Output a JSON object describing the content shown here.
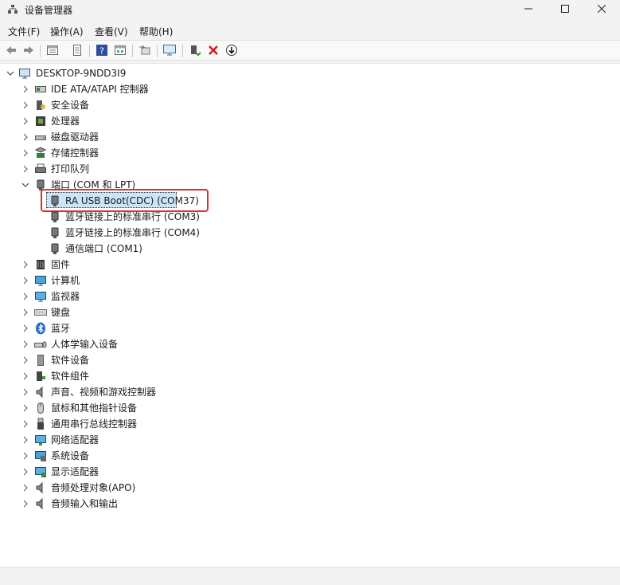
{
  "window": {
    "title": "设备管理器",
    "controls": {
      "minimize": "—",
      "maximize": "☐",
      "close": "✕"
    }
  },
  "menu": [
    "文件(F)",
    "操作(A)",
    "查看(V)",
    "帮助(H)"
  ],
  "toolbar": {
    "icons": [
      "back-arrow-icon",
      "forward-arrow-icon",
      "properties-icon",
      "show-hide-icon",
      "help-icon",
      "device-view-icon",
      "scan-hardware-icon",
      "monitor-icon",
      "update-driver-icon",
      "uninstall-icon",
      "disable-download-icon"
    ]
  },
  "tree": {
    "root": "DESKTOP-9NDD3I9",
    "categories": [
      {
        "label": "IDE ATA/ATAPI 控制器",
        "icon": "ide-controller-icon",
        "expanded": false
      },
      {
        "label": "安全设备",
        "icon": "security-device-icon",
        "expanded": false
      },
      {
        "label": "处理器",
        "icon": "processor-icon",
        "expanded": false
      },
      {
        "label": "磁盘驱动器",
        "icon": "disk-drive-icon",
        "expanded": false
      },
      {
        "label": "存储控制器",
        "icon": "storage-controller-icon",
        "expanded": false
      },
      {
        "label": "打印队列",
        "icon": "printer-icon",
        "expanded": false
      },
      {
        "label": "端口 (COM 和 LPT)",
        "icon": "port-icon",
        "expanded": true,
        "children": [
          {
            "label": "RA USB Boot(CDC) (COM37)",
            "icon": "port-icon",
            "selected": true
          },
          {
            "label": "蓝牙链接上的标准串行 (COM3)",
            "icon": "port-icon"
          },
          {
            "label": "蓝牙链接上的标准串行 (COM4)",
            "icon": "port-icon"
          },
          {
            "label": "通信端口 (COM1)",
            "icon": "port-icon"
          }
        ]
      },
      {
        "label": "固件",
        "icon": "firmware-icon",
        "expanded": false
      },
      {
        "label": "计算机",
        "icon": "computer-icon",
        "expanded": false
      },
      {
        "label": "监视器",
        "icon": "monitor-icon",
        "expanded": false
      },
      {
        "label": "键盘",
        "icon": "keyboard-icon",
        "expanded": false
      },
      {
        "label": "蓝牙",
        "icon": "bluetooth-icon",
        "expanded": false
      },
      {
        "label": "人体学输入设备",
        "icon": "hid-icon",
        "expanded": false
      },
      {
        "label": "软件设备",
        "icon": "software-device-icon",
        "expanded": false
      },
      {
        "label": "软件组件",
        "icon": "software-component-icon",
        "expanded": false
      },
      {
        "label": "声音、视频和游戏控制器",
        "icon": "audio-icon",
        "expanded": false
      },
      {
        "label": "鼠标和其他指针设备",
        "icon": "mouse-icon",
        "expanded": false
      },
      {
        "label": "通用串行总线控制器",
        "icon": "usb-icon",
        "expanded": false
      },
      {
        "label": "网络适配器",
        "icon": "network-adapter-icon",
        "expanded": false
      },
      {
        "label": "系统设备",
        "icon": "system-device-icon",
        "expanded": false
      },
      {
        "label": "显示适配器",
        "icon": "display-adapter-icon",
        "expanded": false
      },
      {
        "label": "音频处理对象(APO)",
        "icon": "audio-icon",
        "expanded": false
      },
      {
        "label": "音频输入和输出",
        "icon": "audio-icon",
        "expanded": false
      }
    ]
  },
  "colors": {
    "selection": "#cce4f7",
    "highlight_border": "#d9312b",
    "accent": "#0067c0"
  }
}
